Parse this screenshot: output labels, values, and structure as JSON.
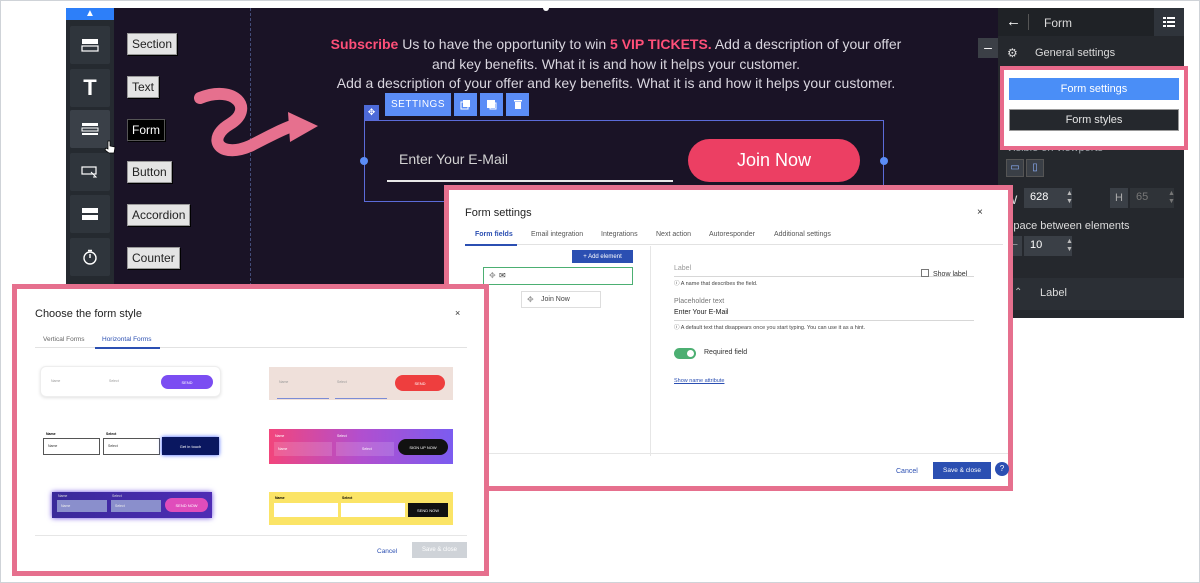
{
  "editor": {
    "element_tags": [
      "Section",
      "Text",
      "Form",
      "Button",
      "Accordion",
      "Counter"
    ],
    "promo": {
      "subscribe": "Subscribe",
      "line1_mid": " Us to have the opportunity to win ",
      "vip": "5 VIP TICKETS.",
      "line1_end": " Add a description of your offer",
      "line2": "and key benefits. What it is and how it helps your customer.",
      "line3": "Add a description of your offer and key benefits. What it is and how it helps your customer."
    },
    "settings_label": "SETTINGS",
    "email_placeholder": "Enter Your E-Mail",
    "join_button": "Join Now",
    "minus": "–"
  },
  "right_panel": {
    "title": "Form",
    "general_settings": "General settings",
    "form_settings_button": "Form settings",
    "form_styles_button": "Form styles",
    "visible_on_viewports": "Visible on viewports",
    "w_label": "W",
    "w_value": "628",
    "h_label": "H",
    "h_value": "65",
    "space_between": "Space between elements",
    "space_value": "10",
    "label_section": "Label"
  },
  "form_settings_dialog": {
    "title": "Form settings",
    "close": "×",
    "tabs": [
      "Form fields",
      "Email integration",
      "Integrations",
      "Next action",
      "Autoresponder",
      "Additional settings"
    ],
    "add_element": "+ Add element",
    "join_now": "Join Now",
    "label_field": "Label",
    "label_hint": "A name that describes the field.",
    "show_label": "Show label",
    "placeholder_label": "Placeholder text",
    "placeholder_value": "Enter Your E-Mail",
    "placeholder_hint": "A default text that disappears once you start typing. You can use it as a hint.",
    "required_field": "Required field",
    "show_name_attribute": "Show name attribute",
    "cancel": "Cancel",
    "save_close": "Save & close"
  },
  "choose_style_dialog": {
    "title": "Choose the form style",
    "close": "×",
    "tabs": [
      "Vertical Forms",
      "Horizontal Forms"
    ],
    "cancel": "Cancel",
    "save_close": "Save & close",
    "templates": {
      "t1": {
        "name": "Name",
        "select": "Select",
        "button": "SEND"
      },
      "t2": {
        "name": "Name",
        "select": "Select",
        "button": "SEND"
      },
      "t3": {
        "name_label": "Name",
        "select_label": "Select",
        "name_ph": "Name",
        "select_ph": "Select",
        "button": "Get in touch"
      },
      "t4": {
        "name_label": "Name",
        "select_label": "Select",
        "name_ph": "Name",
        "select_ph": "Select",
        "button": "SIGN UP NOW"
      },
      "t5": {
        "name_label": "Name",
        "select_label": "Select",
        "name_ph": "Name",
        "select_ph": "Select",
        "button": "SEND NOW"
      },
      "t6": {
        "name_label": "Name",
        "select_label": "Select",
        "button": "SEND NOW"
      }
    }
  },
  "colors": {
    "accent_pink": "#ec3f63",
    "highlight_border": "#e6708e",
    "primary_blue": "#2b4fb2",
    "editor_bg": "#1a1326"
  }
}
